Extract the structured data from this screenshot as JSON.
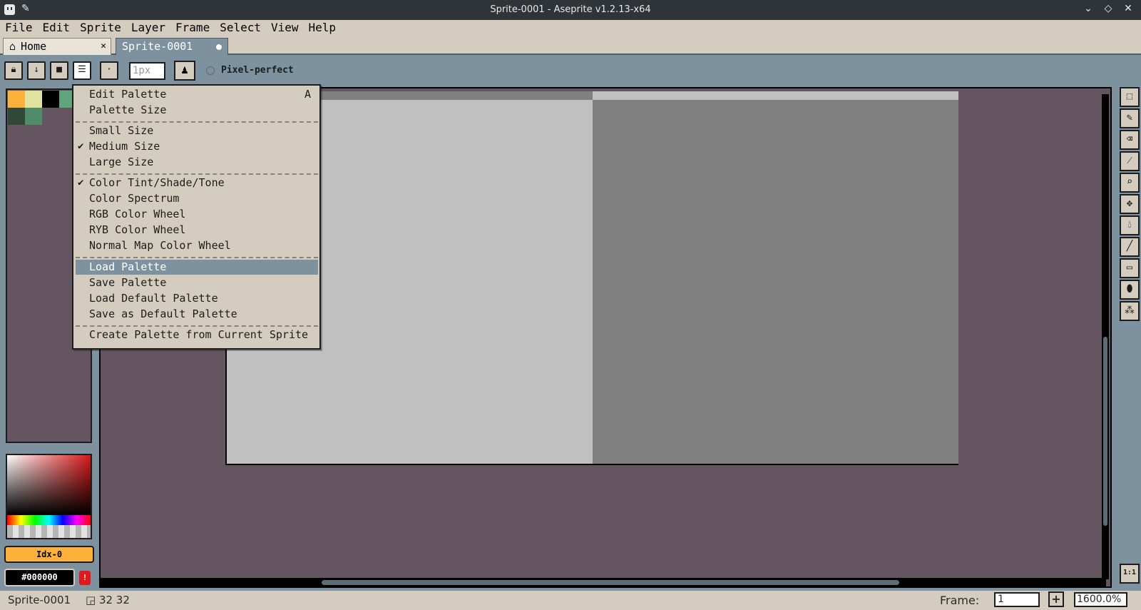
{
  "window": {
    "title": "Sprite-0001 - Aseprite v1.2.13-x64"
  },
  "menubar": [
    "File",
    "Edit",
    "Sprite",
    "Layer",
    "Frame",
    "Select",
    "View",
    "Help"
  ],
  "tabs": {
    "home": "Home",
    "sprite": "Sprite-0001"
  },
  "toolbar": {
    "brush_size_placeholder": "1px",
    "pixel_perfect": "Pixel-perfect"
  },
  "palette": {
    "colors": [
      "#fbb13a",
      "#e2e2a0",
      "#000000",
      "#5fa57e",
      "#304838",
      "#4f8c6a"
    ]
  },
  "color_bar": {
    "index": "Idx-0",
    "hex": "#000000",
    "warning_icon": "!"
  },
  "dropdown": {
    "items": [
      {
        "label": "Edit Palette",
        "shortcut": "A"
      },
      {
        "label": "Palette Size"
      },
      {
        "label": "Small Size"
      },
      {
        "label": "Medium Size",
        "checked": true
      },
      {
        "label": "Large Size"
      },
      {
        "label": "Color Tint/Shade/Tone",
        "checked": true
      },
      {
        "label": "Color Spectrum"
      },
      {
        "label": "RGB Color Wheel"
      },
      {
        "label": "RYB Color Wheel"
      },
      {
        "label": "Normal Map Color Wheel"
      },
      {
        "label": "Load Palette",
        "highlighted": true
      },
      {
        "label": "Save Palette"
      },
      {
        "label": "Load Default Palette"
      },
      {
        "label": "Save as Default Palette"
      },
      {
        "label": "Create Palette from Current Sprite"
      }
    ]
  },
  "status": {
    "sprite_name": "Sprite-0001",
    "dimensions": "32 32",
    "frame_label": "Frame:",
    "frame_value": "1",
    "zoom": "1600.0%"
  },
  "tools": [
    "rectangular-marquee",
    "pencil",
    "eraser",
    "eyedropper",
    "zoom",
    "move",
    "paint-bucket",
    "line",
    "rectangle",
    "contour",
    "blur"
  ],
  "tools_ratio": "1:1"
}
